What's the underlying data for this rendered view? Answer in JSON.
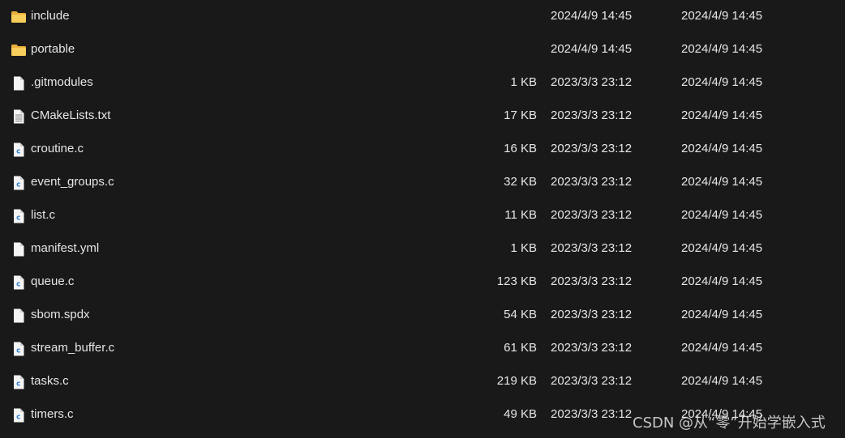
{
  "files": [
    {
      "name": "include",
      "size": "",
      "created": "2024/4/9 14:45",
      "modified": "2024/4/9 14:45",
      "icon": "folder-icon"
    },
    {
      "name": "portable",
      "size": "",
      "created": "2024/4/9 14:45",
      "modified": "2024/4/9 14:45",
      "icon": "folder-icon"
    },
    {
      "name": ".gitmodules",
      "size": "1 KB",
      "created": "2023/3/3 23:12",
      "modified": "2024/4/9 14:45",
      "icon": "file-icon"
    },
    {
      "name": "CMakeLists.txt",
      "size": "17 KB",
      "created": "2023/3/3 23:12",
      "modified": "2024/4/9 14:45",
      "icon": "text-file-icon"
    },
    {
      "name": "croutine.c",
      "size": "16 KB",
      "created": "2023/3/3 23:12",
      "modified": "2024/4/9 14:45",
      "icon": "c-file-icon"
    },
    {
      "name": "event_groups.c",
      "size": "32 KB",
      "created": "2023/3/3 23:12",
      "modified": "2024/4/9 14:45",
      "icon": "c-file-icon"
    },
    {
      "name": "list.c",
      "size": "11 KB",
      "created": "2023/3/3 23:12",
      "modified": "2024/4/9 14:45",
      "icon": "c-file-icon"
    },
    {
      "name": "manifest.yml",
      "size": "1 KB",
      "created": "2023/3/3 23:12",
      "modified": "2024/4/9 14:45",
      "icon": "file-icon"
    },
    {
      "name": "queue.c",
      "size": "123 KB",
      "created": "2023/3/3 23:12",
      "modified": "2024/4/9 14:45",
      "icon": "c-file-icon"
    },
    {
      "name": "sbom.spdx",
      "size": "54 KB",
      "created": "2023/3/3 23:12",
      "modified": "2024/4/9 14:45",
      "icon": "file-icon"
    },
    {
      "name": "stream_buffer.c",
      "size": "61 KB",
      "created": "2023/3/3 23:12",
      "modified": "2024/4/9 14:45",
      "icon": "c-file-icon"
    },
    {
      "name": "tasks.c",
      "size": "219 KB",
      "created": "2023/3/3 23:12",
      "modified": "2024/4/9 14:45",
      "icon": "c-file-icon"
    },
    {
      "name": "timers.c",
      "size": "49 KB",
      "created": "2023/3/3 23:12",
      "modified": "2024/4/9 14:45",
      "icon": "c-file-icon"
    }
  ],
  "watermark": "CSDN @从“零”开始学嵌入式",
  "colors": {
    "background": "#191919",
    "text": "#e6e6e6",
    "folder": "#f4c552",
    "c_badge": "#2f7fd1"
  }
}
